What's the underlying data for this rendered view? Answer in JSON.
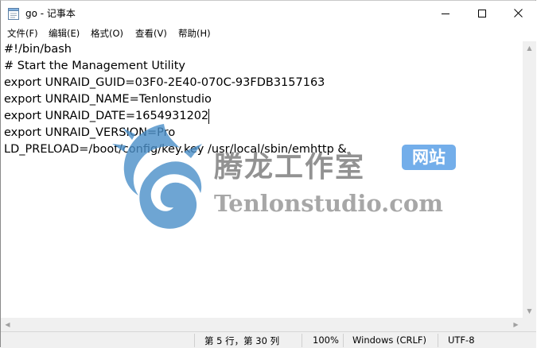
{
  "window": {
    "title": "go - 记事本",
    "controls": {
      "minimize_icon": "minimize-icon",
      "maximize_icon": "maximize-icon",
      "close_icon": "close-icon"
    }
  },
  "menu": {
    "items": [
      "文件(F)",
      "编辑(E)",
      "格式(O)",
      "查看(V)",
      "帮助(H)"
    ]
  },
  "editor": {
    "lines": [
      "#!/bin/bash",
      "# Start the Management Utility",
      "export UNRAID_GUID=03F0-2E40-070C-93FDB3157163",
      "export UNRAID_NAME=Tenlonstudio",
      "export UNRAID_DATE=1654931202",
      "export UNRAID_VERSION=Pro",
      "LD_PRELOAD=/boot/config/key.key /usr/local/sbin/emhttp &"
    ]
  },
  "watermark": {
    "chinese": "腾龙工作室",
    "badge": "网站",
    "english": "Tenlonstudio.com",
    "badge_color": "#5aa0e6",
    "dragon_color": "#4a8fc8"
  },
  "status": {
    "position": "第 5 行，第 30 列",
    "zoom": "100%",
    "line_ending": "Windows (CRLF)",
    "encoding": "UTF-8"
  }
}
